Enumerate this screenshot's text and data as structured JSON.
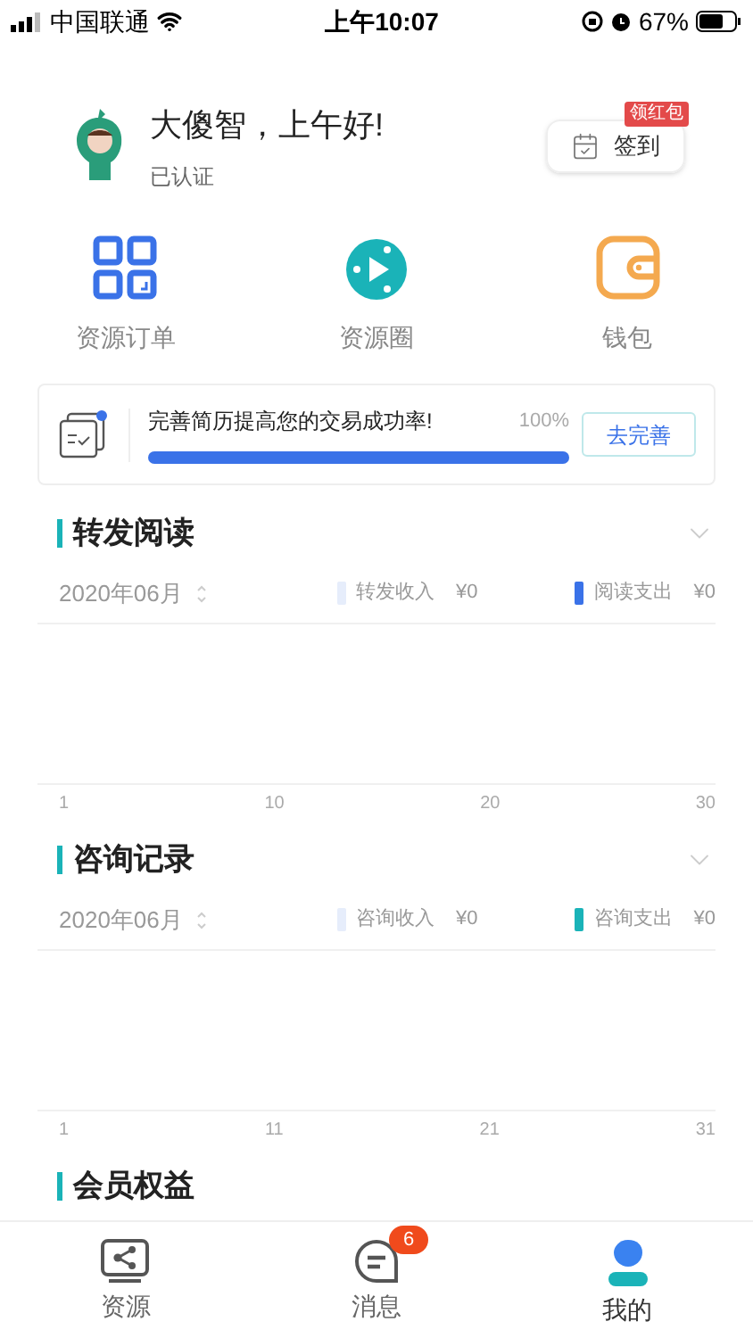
{
  "status_bar": {
    "carrier": "中国联通",
    "time": "上午10:07",
    "battery": "67%"
  },
  "profile": {
    "greeting": "大傻智，上午好!",
    "status": "已认证",
    "checkin": {
      "label": "签到",
      "badge": "领红包"
    }
  },
  "shortcuts": [
    {
      "kind": "grid",
      "label": "资源订单"
    },
    {
      "kind": "play",
      "label": "资源圈"
    },
    {
      "kind": "wallet",
      "label": "钱包"
    }
  ],
  "resume_card": {
    "text": "完善简历提高您的交易成功率!",
    "percent": "100%",
    "level": 1,
    "button": "去完善"
  },
  "sections": [
    {
      "title": "转发阅读",
      "expanded": false,
      "month": "2020年06月",
      "legend": [
        {
          "label": "转发收入",
          "amount": "¥0",
          "color": "#e6edfb"
        },
        {
          "label": "阅读支出",
          "amount": "¥0",
          "color": "#3a72e8"
        }
      ],
      "x_labels": [
        "1",
        "10",
        "20",
        "30"
      ]
    },
    {
      "title": "咨询记录",
      "expanded": false,
      "month": "2020年06月",
      "legend": [
        {
          "label": "咨询收入",
          "amount": "¥0",
          "color": "#e6edfb"
        },
        {
          "label": "咨询支出",
          "amount": "¥0",
          "color": "#1ab3b8"
        }
      ],
      "x_labels": [
        "1",
        "11",
        "21",
        "31"
      ]
    },
    {
      "title": "会员权益"
    }
  ],
  "tab_bar": [
    {
      "kind": "resource",
      "label": "资源",
      "selected": false
    },
    {
      "kind": "message",
      "label": "消息",
      "selected": false,
      "badge": "6"
    },
    {
      "kind": "me",
      "label": "我的",
      "selected": true
    }
  ]
}
